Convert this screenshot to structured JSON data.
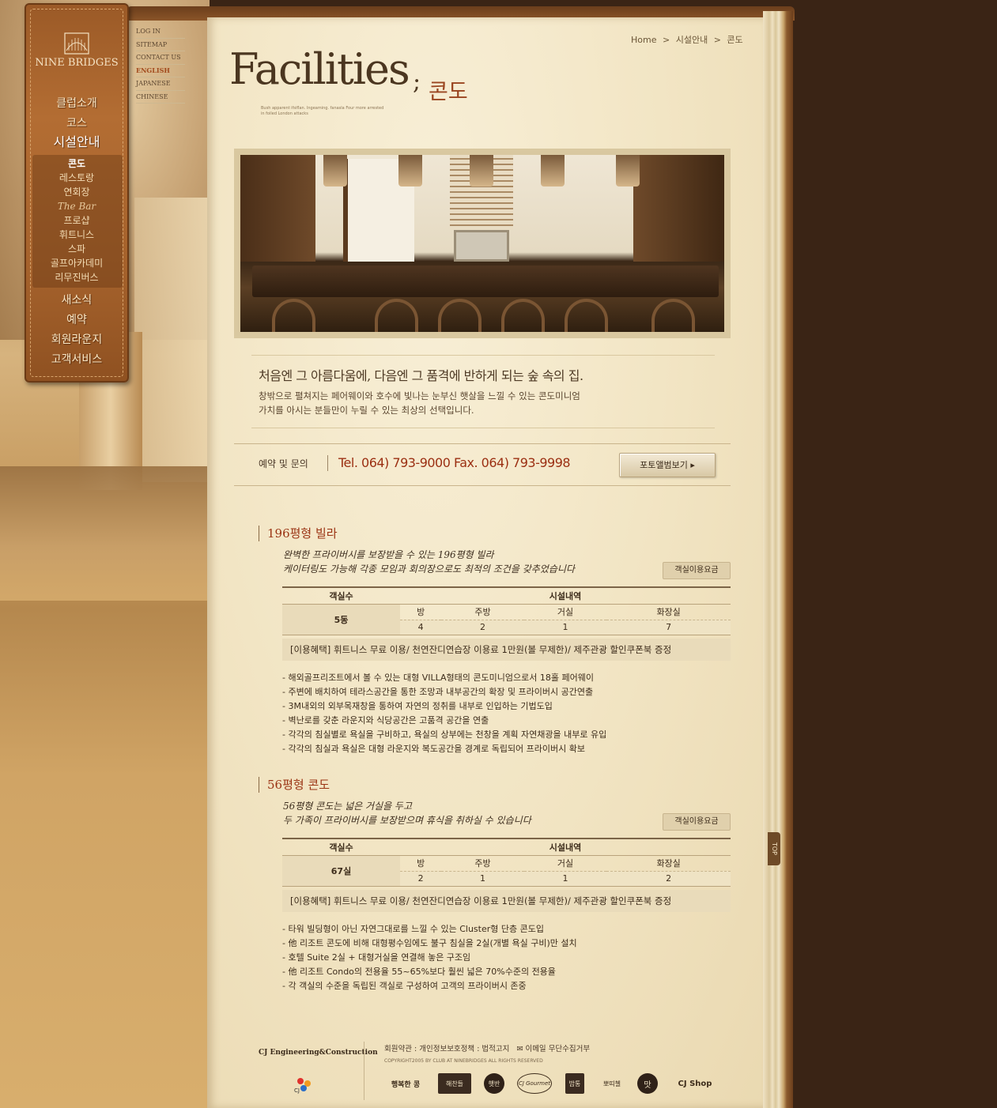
{
  "logo": {
    "name": "NINE BRIDGES",
    "emblem": "bridge-emblem-icon"
  },
  "nav": {
    "main_top": [
      "클럽소개",
      "코스",
      "시설안내"
    ],
    "sub": [
      "콘도",
      "레스토랑",
      "연회장",
      "The Bar",
      "프로샵",
      "휘트니스",
      "스파",
      "골프아카데미",
      "리무진버스"
    ],
    "main_bottom": [
      "새소식",
      "예약",
      "회원라운지",
      "고객서비스"
    ]
  },
  "util_links": [
    "LOG IN",
    "SITEMAP",
    "CONTACT US",
    "ENGLISH",
    "JAPANESE",
    "CHINESE"
  ],
  "breadcrumb": {
    "home": "Home",
    "level1": "시설안내",
    "level2": "콘도",
    "sep": ">"
  },
  "title": {
    "big": "Facilities",
    "semi": ";",
    "kor": "콘도",
    "sub": "Bush apparent ifsiflan. Ingeaming. fanasla Four more arrested in foiled London attacks"
  },
  "intro": {
    "headline": "처음엔 그 아름다움에, 다음엔 그 품격에 반하게 되는 숲 속의 집.",
    "line1": "창밖으로 펼쳐지는 페어웨이와 호수에 빛나는 눈부신 햇살을 느낄 수 있는 콘도미니엄",
    "line2": "가치를 아시는 분들만이 누릴 수 있는 최상의 선택입니다."
  },
  "contact": {
    "label": "예약 및 문의",
    "tel": "Tel. 064) 793-9000  Fax. 064) 793-9998",
    "album_button": "포토앨범보기 ▸"
  },
  "sections": [
    {
      "title": "196평형 빌라",
      "desc1": "완벽한 프라이버시를 보장받을 수 있는 196평형 빌라",
      "desc2": "케이터링도 가능해 각종 모임과 회의장으로도  최적의 조건을 갖추었습니다",
      "fee_button": "객실이용요금",
      "table": {
        "h_count": "객실수",
        "h_facility": "시설내역",
        "count": "5동",
        "cols": [
          "방",
          "주방",
          "거실",
          "화장실"
        ],
        "vals": [
          "4",
          "2",
          "1",
          "7"
        ]
      },
      "benefit": "[이용혜택] 휘트니스 무료 이용/ 천연잔디연습장 이용료 1만원(볼 무제한)/ 제주관광 할인쿠폰북 증정",
      "points": [
        "- 해외골프리조트에서 볼 수 있는 대형 VILLA형태의 콘도미니엄으로서 18홀 페어웨이",
        "- 주변에 배치하여 테라스공간을 통한 조망과 내부공간의 확장 및 프라이버시 공간연출",
        "- 3M내외의 외부목재창을 통하여 자연의 정취를 내부로 인입하는 기법도입",
        "- 벽난로를 갖춘 라운지와 식당공간은 고품격 공간을 연출",
        "- 각각의 침실별로 욕실을 구비하고, 욕실의 상부에는 천창을 계획 자연채광을 내부로 유입",
        "- 각각의 침실과 욕실은 대형 라운지와 복도공간을 경계로 독립되어 프라이버시 확보"
      ]
    },
    {
      "title": "56평형 콘도",
      "desc1": "56평형 콘도는 넓은 거실을 두고",
      "desc2": "두 가족이 프라이버시를 보장받으며 휴식을 취하실 수 있습니다",
      "fee_button": "객실이용요금",
      "table": {
        "h_count": "객실수",
        "h_facility": "시설내역",
        "count": "67실",
        "cols": [
          "방",
          "주방",
          "거실",
          "화장실"
        ],
        "vals": [
          "2",
          "1",
          "1",
          "2"
        ]
      },
      "benefit": "[이용혜택] 휘트니스 무료 이용/ 천연잔디연습장 이용료 1만원(볼 무제한)/ 제주관광 할인쿠폰북 증정",
      "points": [
        "- 타워 빌딩형이 아닌 자연그대로를 느낄 수 있는 Cluster형 단층 콘도입",
        "- 他 리조트 콘도에 비해 대형평수임에도 불구 침실을 2실(개별 욕실 구비)만 설치",
        "- 호텔 Suite 2실 + 대형거실을 연결해 놓은 구조임",
        "- 他 리조트 Condo의 전용율 55~65%보다 훨씬 넓은 70%수준의 전용율",
        "- 각 객실의 수준을 독립된 객실로 구성하여 고객의 프라이버시 존중"
      ]
    }
  ],
  "top_button": "TOP",
  "footer": {
    "company": "CJ Engineering&Construction",
    "cj_logo": "CJ",
    "links": [
      "회원약관",
      "개인정보보호정책",
      "법적고지",
      "이메일 무단수집거부"
    ],
    "copyright": "COPYRIGHT2005 BY CLUB AT NINEBRIDGES ALL RIGHTS RESERVED",
    "brands": [
      "행복한 콩",
      "해찬들",
      "햇반",
      "CJ Gourmet",
      "밥통",
      "뽀띠첼",
      "맛",
      "CJ Shop"
    ]
  },
  "colors": {
    "accent": "#9b3414",
    "page": "#f2e5c4",
    "nav": "#a5622c"
  }
}
